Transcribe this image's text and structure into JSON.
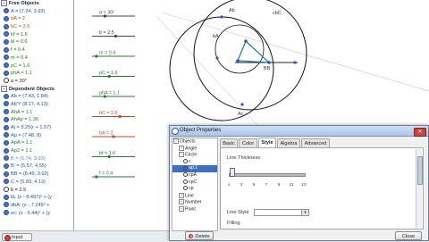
{
  "algebra": {
    "rows": [
      {
        "kind": "header",
        "text": "Free Objects",
        "toggle": "−"
      },
      {
        "kind": "item",
        "text": "A = (7.24, 3.93)",
        "color": "#1b4fb5",
        "filled": true
      },
      {
        "kind": "item",
        "text": "bA = 2",
        "color": "#c34a20",
        "filled": true
      },
      {
        "kind": "item",
        "text": "bC = 2.6",
        "color": "#c34a20",
        "filled": true
      },
      {
        "kind": "item",
        "text": "bf = 1.6",
        "color": "#1e7a2a",
        "filled": true
      },
      {
        "kind": "item",
        "text": "bl = 0.6",
        "color": "#1e7a2a",
        "filled": true
      },
      {
        "kind": "item",
        "text": "f = 0.4",
        "color": "#1e7a2a",
        "filled": true
      },
      {
        "kind": "item",
        "text": "m = 0.4",
        "color": "#1e7a2a",
        "filled": true
      },
      {
        "kind": "item",
        "text": "pC = 1.6",
        "color": "#1e7a2a",
        "filled": true
      },
      {
        "kind": "item",
        "text": "phA = 1.1",
        "color": "#1e7a2a",
        "filled": true
      },
      {
        "kind": "item",
        "text": "a = 30°",
        "color": "#222222",
        "filled": false
      },
      {
        "kind": "header",
        "text": "Dependent Objects",
        "toggle": "−"
      },
      {
        "kind": "item",
        "text": "Ab = (7.43, 1.84)",
        "color": "#1b4fb5",
        "filled": true
      },
      {
        "kind": "item",
        "text": "Ab'Y (8.17, 4.13)",
        "color": "#1b4fb5",
        "filled": true
      },
      {
        "kind": "item",
        "text": "AhA = 1.1",
        "color": "#1e7a2a",
        "filled": true
      },
      {
        "kind": "item",
        "text": "AhAp = 1.36",
        "color": "#1e7a2a",
        "filled": true
      },
      {
        "kind": "item",
        "text": "Aj = 5.25(r + 1.57)",
        "color": "#1b4fb5",
        "filled": true
      },
      {
        "kind": "item",
        "text": "Ap = (7.48, 8)",
        "color": "#1b4fb5",
        "filled": true
      },
      {
        "kind": "item",
        "text": "ApA = 1.1",
        "color": "#1e7a2a",
        "filled": true
      },
      {
        "kind": "item",
        "text": "Ap2 = 1.1",
        "color": "#1e7a2a",
        "filled": true
      },
      {
        "kind": "item",
        "text": "B = (5.74, 3.93)",
        "color": "#5a7fd0",
        "filled": true
      },
      {
        "kind": "item",
        "text": "B' = (5.57, 4.55)",
        "color": "#1b4fb5",
        "filled": true
      },
      {
        "kind": "item",
        "text": "BB = (8.49, 3.93)",
        "color": "#1b4fb5",
        "filled": true
      },
      {
        "kind": "item",
        "text": "C = (5.83, 4.13)",
        "color": "#1b4fb5",
        "filled": true
      },
      {
        "kind": "item",
        "text": "b = 2.5",
        "color": "#222222",
        "filled": false
      },
      {
        "kind": "item",
        "text": "bL (x - 8.497)² + (y",
        "color": "#1b4fb5",
        "filled": true
      },
      {
        "kind": "item",
        "text": "dbA: (x - 7.249² +",
        "color": "#1b4fb5",
        "filled": true
      },
      {
        "kind": "item",
        "text": "ec: (x - 5.44)² + (y",
        "color": "#1b4fb5",
        "filled": true
      }
    ]
  },
  "graphics": {
    "sliders": [
      {
        "label": "α = 30°",
        "value": 0.3,
        "color": "#444444"
      },
      {
        "label": "b = 2.5",
        "value": 0.55,
        "color": "#444444"
      },
      {
        "label": "m = 0.4",
        "value": 0.1,
        "color": "#2a7a36"
      },
      {
        "label": "pC = 1.6",
        "value": 0.4,
        "color": "#2a7a36"
      },
      {
        "label": "phA = 1.1",
        "value": 0.3,
        "color": "#2a7a36"
      },
      {
        "label": "bC = 2.6",
        "value": 0.65,
        "color": "#c34a20"
      },
      {
        "label": "bA = 2",
        "value": 0.5,
        "color": "#c34a20"
      },
      {
        "label": "bf = 1.6",
        "value": 0.4,
        "color": "#2a7a36"
      },
      {
        "label": "f = 0.4",
        "value": 0.1,
        "color": "#2a7a36"
      }
    ],
    "labels": {
      "ab": "Ab",
      "cbc": "cbC",
      "bA": "bA",
      "bB": "BB",
      "ac": "Ac"
    }
  },
  "status": {
    "button": "Input"
  },
  "dialog": {
    "title": "Object Properties",
    "close": "✕",
    "tree": [
      {
        "level": 1,
        "text": "Objects",
        "exp": "−"
      },
      {
        "level": 2,
        "text": "Angle",
        "exp": "+"
      },
      {
        "level": 2,
        "text": "Circle",
        "exp": "−"
      },
      {
        "level": 3,
        "text": "c"
      },
      {
        "level": 3,
        "text": "ap.1",
        "sel": true
      },
      {
        "level": 3,
        "text": "cpA"
      },
      {
        "level": 3,
        "text": "cpC"
      },
      {
        "level": 3,
        "text": "cp"
      },
      {
        "level": 2,
        "text": "Line",
        "exp": "+"
      },
      {
        "level": 2,
        "text": "Number",
        "exp": "+"
      },
      {
        "level": 2,
        "text": "Point",
        "exp": "+"
      }
    ],
    "tabs": [
      "Basic",
      "Color",
      "Style",
      "Algebra",
      "Advanced"
    ],
    "active_tab": 2,
    "line_thickness_label": "Line Thickness",
    "ticks": [
      "1",
      "3",
      "5",
      "7",
      "9",
      "11",
      "13"
    ],
    "line_style_label": "Line Style",
    "filling_label": "Filling",
    "delete_label": "Delete",
    "close_label": "Close"
  }
}
